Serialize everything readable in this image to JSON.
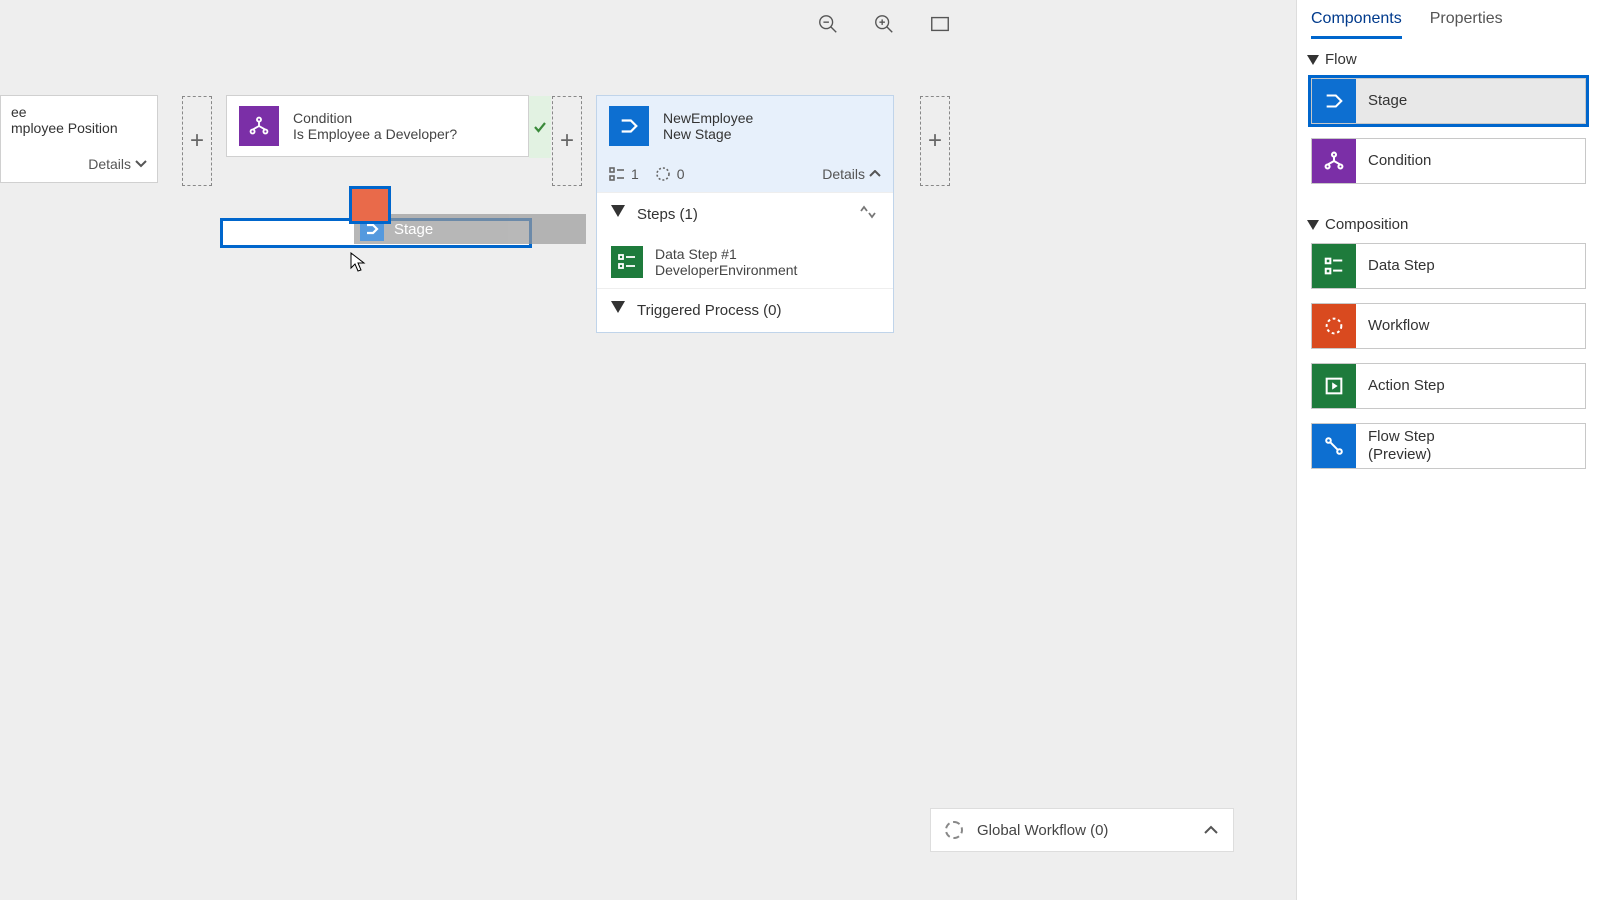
{
  "toolbar": {
    "zoom_out": "zoom-out",
    "zoom_in": "zoom-in",
    "fit": "fit-screen"
  },
  "canvas": {
    "partial_stage": {
      "line1": "ee",
      "line2": "mployee Position",
      "details": "Details"
    },
    "condition": {
      "type": "Condition",
      "question": "Is Employee a Developer?"
    },
    "drag_ghost": {
      "label": "Stage"
    },
    "expanded_stage": {
      "name": "NewEmployee",
      "subtitle": "New Stage",
      "stat1": "1",
      "stat2": "0",
      "details": "Details",
      "steps_header": "Steps (1)",
      "step1_title": "Data Step #1",
      "step1_sub": "DeveloperEnvironment",
      "triggered": "Triggered Process (0)"
    }
  },
  "global_workflow": "Global Workflow (0)",
  "sidepanel": {
    "tabs": {
      "components": "Components",
      "properties": "Properties"
    },
    "section_flow": "Flow",
    "section_composition": "Composition",
    "items": {
      "stage": "Stage",
      "condition": "Condition",
      "data_step": "Data Step",
      "workflow": "Workflow",
      "action_step": "Action Step",
      "flow_step_l1": "Flow Step",
      "flow_step_l2": "(Preview)"
    }
  }
}
